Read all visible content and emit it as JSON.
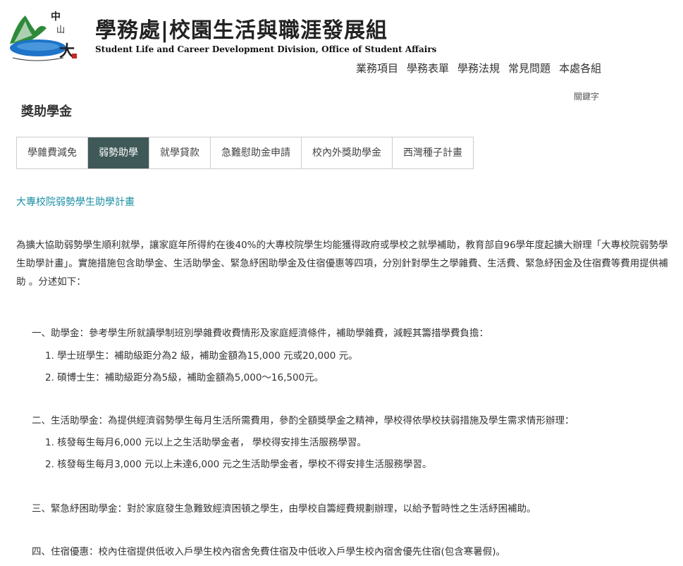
{
  "header": {
    "title_zh": "學務處|校園生活與職涯發展組",
    "title_en": "Student Life and Career Development Division, Office of Student Affairs",
    "nav": [
      "業務項目",
      "學務表單",
      "學務法規",
      "常見問題",
      "本處各組"
    ],
    "keyword_label": "關鍵字"
  },
  "page": {
    "title": "獎助學金",
    "tabs": [
      {
        "label": "學雜費減免",
        "active": false
      },
      {
        "label": "弱勢助學",
        "active": true
      },
      {
        "label": "就學貸款",
        "active": false
      },
      {
        "label": "急難慰助金申請",
        "active": false
      },
      {
        "label": "校內外獎助學金",
        "active": false
      },
      {
        "label": "西灣種子計畫",
        "active": false
      }
    ]
  },
  "article": {
    "heading": "大專校院弱勢學生助學計畫",
    "intro": "為擴大協助弱勢學生順利就學，讓家庭年所得約在後40%的大專校院學生均能獲得政府或學校之就學補助，教育部自96學年度起擴大辦理「大專校院弱勢學生助學計畫」。實施措施包含助學金、生活助學金、緊急紓困助學金及住宿優惠等四項，分別針對學生之學雜費、生活費、緊急紓困金及住宿費等費用提供補助 。分述如下：",
    "sec1": "一、助學金：參考學生所就讀學制班別學雜費收費情形及家庭經濟條件，補助學雜費，減輕其籌措學費負擔：",
    "sec1_1": "1. 學士班學生：補助級距分為2 級，補助金額為15,000 元或20,000 元。",
    "sec1_2": "2. 碩博士生：補助級距分為5級，補助金額為5,000～16,500元。",
    "sec2": "二、生活助學金：為提供經濟弱勢學生每月生活所需費用，參酌全額獎學金之精神，學校得依學校扶弱措施及學生需求情形辦理：",
    "sec2_1": "1. 核發每生每月6,000 元以上之生活助學金者， 學校得安排生活服務學習。",
    "sec2_2": "2. 核發每生每月3,000 元以上未達6,000 元之生活助學金者，學校不得安排生活服務學習。",
    "sec3": "三、緊急紓困助學金：對於家庭發生急難致經濟困頓之學生，由學校自籌經費規劃辦理，以給予暫時性之生活紓困補助。",
    "sec4": "四、住宿優惠：校內住宿提供低收入戶學生校內宿舍免費住宿及中低收入戶學生校內宿舍優先住宿(包含寒暑假)。"
  },
  "colors": {
    "accent": "#1b8fa6",
    "active_tab": "#3f5858"
  }
}
